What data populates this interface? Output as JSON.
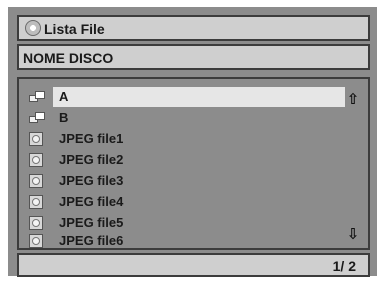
{
  "window": {
    "title": "Lista File"
  },
  "disc": {
    "name": "NOME DISCO"
  },
  "files": [
    {
      "label": "A",
      "type": "folder",
      "selected": true
    },
    {
      "label": "B",
      "type": "folder",
      "selected": false
    },
    {
      "label": "JPEG file1",
      "type": "jpeg",
      "selected": false
    },
    {
      "label": "JPEG file2",
      "type": "jpeg",
      "selected": false
    },
    {
      "label": "JPEG file3",
      "type": "jpeg",
      "selected": false
    },
    {
      "label": "JPEG file4",
      "type": "jpeg",
      "selected": false
    },
    {
      "label": "JPEG file5",
      "type": "jpeg",
      "selected": false
    },
    {
      "label": "JPEG file6",
      "type": "jpeg",
      "selected": false
    }
  ],
  "scroll": {
    "up_icon": "up-arrow-icon",
    "down_icon": "down-arrow-icon"
  },
  "status": {
    "page": "1/ 2"
  },
  "icons": {
    "title": "disc-icon",
    "folder": "folder-icon",
    "jpeg": "jpeg-file-icon"
  }
}
